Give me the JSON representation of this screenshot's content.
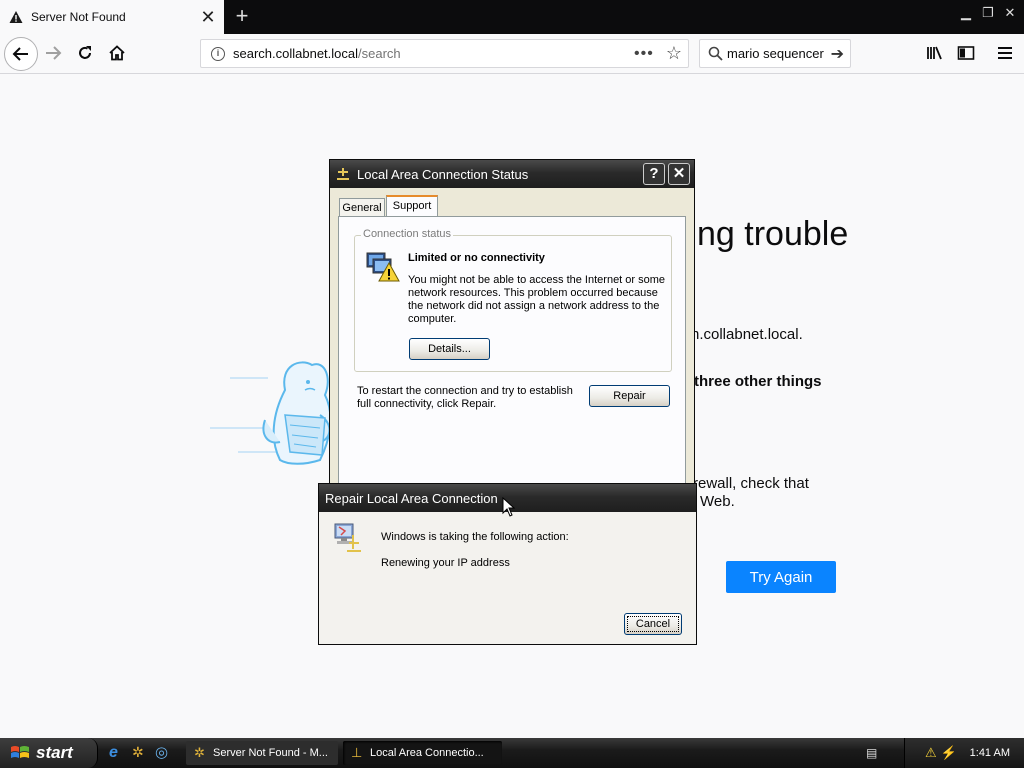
{
  "browser": {
    "tab_title": "Server Not Found",
    "tab_close": "✕",
    "new_tab": "+",
    "url_host": "search.collabnet.local",
    "url_path": "/search",
    "url_menu": "•••",
    "search_value": "mario sequencer"
  },
  "page": {
    "title_fragment": "ng trouble",
    "host_fragment": "h.collabnet.local.",
    "things_fragment": "three other things",
    "firewall_fragment": "rewall, check that",
    "web_fragment": "Web.",
    "try_again": "Try Again"
  },
  "status_dialog": {
    "title": "Local Area Connection Status",
    "help_btn": "?",
    "close_btn": "✕",
    "tabs": [
      "General",
      "Support"
    ],
    "active_tab": "Support",
    "group_label": "Connection status",
    "status_heading": "Limited or no connectivity",
    "status_body": "You might not be able to access the Internet or some network resources. This problem occurred because the network did not assign a network address to the computer.",
    "details_button": "Details...",
    "repair_text": "To restart the connection and try to establish full connectivity, click Repair.",
    "repair_button": "Repair"
  },
  "repair_dialog": {
    "title": "Repair Local Area Connection",
    "line1": "Windows is taking the following action:",
    "line2": "Renewing your IP address",
    "cancel_button": "Cancel"
  },
  "taskbar": {
    "start": "start",
    "items": [
      "Server Not Found - M...",
      "Local Area Connectio..."
    ],
    "clock": "1:41 AM"
  },
  "colors": {
    "accent": "#0a84ff",
    "tab_bar": "#0c0c0d",
    "dialog_title": "#2a2a2a"
  }
}
